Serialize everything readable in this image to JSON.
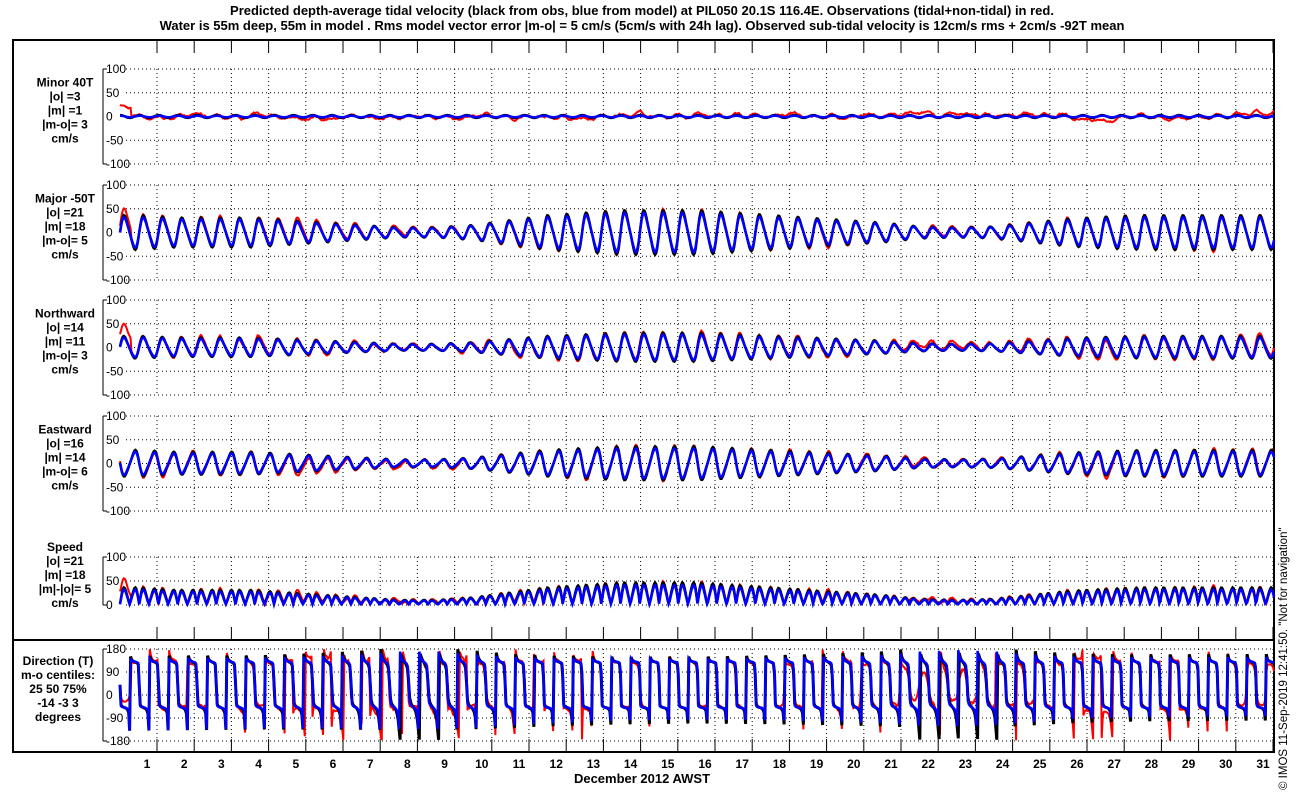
{
  "chart_data": {
    "type": "line",
    "title_lines": [
      "Predicted depth-average tidal velocity (black from obs, blue from model) at PIL050 20.1S 116.4E. Observations (tidal+non-tidal) in red.",
      "Water is 55m deep, 55m in model . Rms model vector error |m-o| = 5 cm/s (5cm/s with 24h lag). Observed sub-tidal velocity is 12cm/s rms + 2cm/s -92T mean"
    ],
    "xlabel": "December 2012 AWST",
    "x_ticks": [
      "1",
      "2",
      "3",
      "4",
      "5",
      "6",
      "7",
      "8",
      "9",
      "10",
      "11",
      "12",
      "13",
      "14",
      "15",
      "16",
      "17",
      "18",
      "19",
      "20",
      "21",
      "22",
      "23",
      "24",
      "25",
      "26",
      "27",
      "28",
      "29",
      "30",
      "31"
    ],
    "credit": "© IMOS 11-Sep-2019 12:41:50. \"Not for navigation\"",
    "series_legend": {
      "obs_tidal": "black",
      "model": "blue",
      "observations": "red"
    },
    "colors": {
      "obs": "#000000",
      "model": "#0000ff",
      "raw": "#ff0000"
    },
    "major_daily_amplitude_cm_s": [
      35,
      30,
      30,
      30,
      25,
      20,
      15,
      10,
      10,
      15,
      25,
      35,
      40,
      45,
      45,
      45,
      40,
      35,
      30,
      25,
      20,
      12,
      10,
      12,
      20,
      28,
      32,
      35,
      35,
      35,
      35
    ],
    "panels": [
      {
        "key": "minor",
        "label": [
          "Minor 40T",
          "|o| =3",
          "|m| =1",
          "|m-o|= 3",
          "cm/s"
        ],
        "ylim": [
          -100,
          100
        ],
        "yticks": [
          "100",
          "50",
          "0",
          "-50",
          "-100"
        ]
      },
      {
        "key": "major",
        "label": [
          "Major -50T",
          "|o| =21",
          "|m| =18",
          "|m-o|= 5",
          "cm/s"
        ],
        "ylim": [
          -100,
          100
        ],
        "yticks": [
          "100",
          "50",
          "0",
          "-50",
          "-100"
        ]
      },
      {
        "key": "north",
        "label": [
          "Northward",
          "|o| =14",
          "|m| =11",
          "|m-o|= 3",
          "cm/s"
        ],
        "ylim": [
          -100,
          100
        ],
        "yticks": [
          "100",
          "50",
          "0",
          "-50",
          "-100"
        ]
      },
      {
        "key": "east",
        "label": [
          "Eastward",
          "|o| =16",
          "|m| =14",
          "|m-o|= 6",
          "cm/s"
        ],
        "ylim": [
          -100,
          100
        ],
        "yticks": [
          "100",
          "50",
          "0",
          "-50",
          "-100"
        ]
      },
      {
        "key": "speed",
        "label": [
          "Speed",
          "|o| =21",
          "|m| =18",
          "|m|-|o|= 5",
          "cm/s"
        ],
        "ylim": [
          0,
          100
        ],
        "yticks": [
          "100",
          "50",
          "0"
        ]
      },
      {
        "key": "dir",
        "label": [
          "Direction (T)",
          "m-o centiles:",
          "25  50  75%",
          "-14  -3   3",
          "degrees"
        ],
        "ylim": [
          -180,
          180
        ],
        "yticks": [
          "180",
          "90",
          "0",
          "-90",
          "-180"
        ]
      }
    ]
  }
}
